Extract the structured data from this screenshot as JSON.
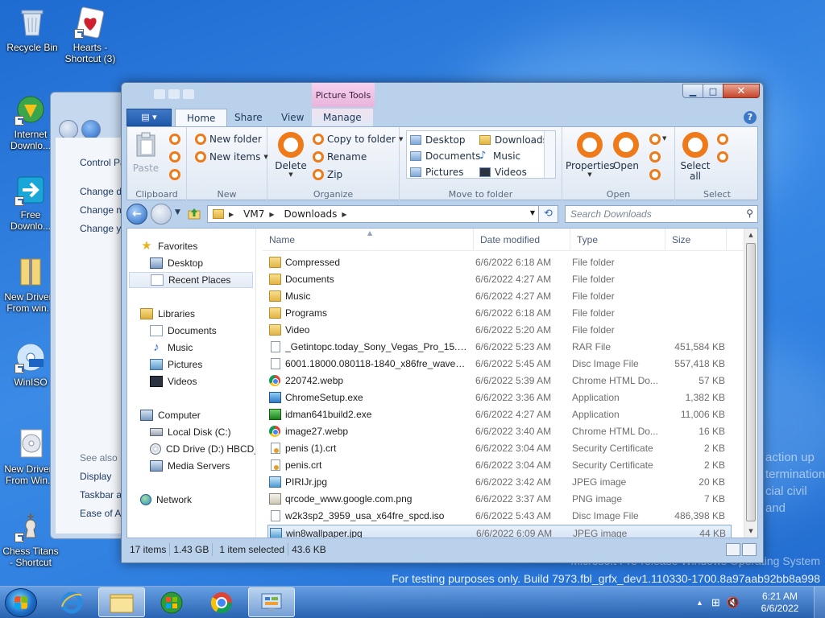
{
  "desktop": {
    "icons": [
      {
        "label": "Recycle Bin"
      },
      {
        "label": "Hearts - Shortcut (3)"
      },
      {
        "label": "Internet Downlo..."
      },
      {
        "label": "Free Downlo..."
      },
      {
        "label": "New Drivers From win..."
      },
      {
        "label": "WinISO"
      },
      {
        "label": "New Drivers From Win..."
      },
      {
        "label": "Chess Titans - Shortcut"
      }
    ],
    "watermark_line1": "Microsoft Pre-release Windows Operating System",
    "watermark_line2": "For testing purposes only. Build 7973.fbl_grfx_dev1.110330-1700.8a97aab92bb8a998",
    "faint_text": [
      "action up",
      "termination",
      "cial civil and"
    ]
  },
  "bg_window": {
    "links": [
      "Control Pa",
      "Change d",
      "Change m",
      "Change yo",
      "See also",
      "Display",
      "Taskbar an",
      "Ease of Ac"
    ]
  },
  "explorer": {
    "context_tab_group": "Picture Tools",
    "file_tab": "▤ ▾",
    "tabs": [
      "Home",
      "Share",
      "View",
      "Manage"
    ],
    "ribbon": {
      "clipboard": {
        "paste": "Paste",
        "label": "Clipboard"
      },
      "new": {
        "new_folder": "New folder",
        "new_items": "New items",
        "label": "New"
      },
      "organize": {
        "delete": "Delete",
        "copy_to": "Copy to folder",
        "rename": "Rename",
        "zip": "Zip",
        "label": "Organize"
      },
      "move": {
        "desktop": "Desktop",
        "downloads": "Downloads",
        "documents": "Documents",
        "music": "Music",
        "pictures": "Pictures",
        "videos": "Videos",
        "label": "Move to folder"
      },
      "open": {
        "properties": "Properties",
        "open": "Open",
        "label": "Open"
      },
      "select": {
        "select_all_1": "Select",
        "select_all_2": "all",
        "label": "Select"
      }
    },
    "address": {
      "segments": [
        "VM7",
        "Downloads"
      ],
      "search_placeholder": "Search Downloads"
    },
    "nav": {
      "favorites": "Favorites",
      "desktop": "Desktop",
      "recent": "Recent Places",
      "libraries": "Libraries",
      "documents": "Documents",
      "music": "Music",
      "pictures": "Pictures",
      "videos": "Videos",
      "computer": "Computer",
      "local_disk": "Local Disk (C:)",
      "cd_drive": "CD Drive (D:) HBCD_",
      "media": "Media Servers",
      "network": "Network"
    },
    "columns": {
      "name": "Name",
      "date": "Date modified",
      "type": "Type",
      "size": "Size"
    },
    "files": [
      {
        "name": "Compressed",
        "date": "6/6/2022 6:18 AM",
        "type": "File folder",
        "size": "",
        "icon": "folder"
      },
      {
        "name": "Documents",
        "date": "6/6/2022 4:27 AM",
        "type": "File folder",
        "size": "",
        "icon": "folder"
      },
      {
        "name": "Music",
        "date": "6/6/2022 4:27 AM",
        "type": "File folder",
        "size": "",
        "icon": "folder"
      },
      {
        "name": "Programs",
        "date": "6/6/2022 6:18 AM",
        "type": "File folder",
        "size": "",
        "icon": "folder"
      },
      {
        "name": "Video",
        "date": "6/6/2022 5:20 AM",
        "type": "File folder",
        "size": "",
        "icon": "folder"
      },
      {
        "name": "_Getintopc.today_Sony_Vegas_Pro_15.0.0...",
        "date": "6/6/2022 5:23 AM",
        "type": "RAR File",
        "size": "451,584 KB",
        "icon": "file"
      },
      {
        "name": "6001.18000.080118-1840_x86fre_wave1_Se...",
        "date": "6/6/2022 5:45 AM",
        "type": "Disc Image File",
        "size": "557,418 KB",
        "icon": "disc"
      },
      {
        "name": "220742.webp",
        "date": "6/6/2022 5:39 AM",
        "type": "Chrome HTML Do...",
        "size": "57 KB",
        "icon": "chrome"
      },
      {
        "name": "ChromeSetup.exe",
        "date": "6/6/2022 3:36 AM",
        "type": "Application",
        "size": "1,382 KB",
        "icon": "app"
      },
      {
        "name": "idman641build2.exe",
        "date": "6/6/2022 4:27 AM",
        "type": "Application",
        "size": "11,006 KB",
        "icon": "idm"
      },
      {
        "name": "image27.webp",
        "date": "6/6/2022 3:40 AM",
        "type": "Chrome HTML Do...",
        "size": "16 KB",
        "icon": "chrome"
      },
      {
        "name": "penis (1).crt",
        "date": "6/6/2022 3:04 AM",
        "type": "Security Certificate",
        "size": "2 KB",
        "icon": "cert"
      },
      {
        "name": "penis.crt",
        "date": "6/6/2022 3:04 AM",
        "type": "Security Certificate",
        "size": "2 KB",
        "icon": "cert"
      },
      {
        "name": "PIRIJr.jpg",
        "date": "6/6/2022 3:42 AM",
        "type": "JPEG image",
        "size": "20 KB",
        "icon": "img"
      },
      {
        "name": "qrcode_www.google.com.png",
        "date": "6/6/2022 3:37 AM",
        "type": "PNG image",
        "size": "7 KB",
        "icon": "png"
      },
      {
        "name": "w2k3sp2_3959_usa_x64fre_spcd.iso",
        "date": "6/6/2022 5:43 AM",
        "type": "Disc Image File",
        "size": "486,398 KB",
        "icon": "disc"
      },
      {
        "name": "win8wallpaper.jpg",
        "date": "6/6/2022 6:09 AM",
        "type": "JPEG image",
        "size": "44 KB",
        "icon": "img",
        "selected": true
      }
    ],
    "status": {
      "items": "17 items",
      "size": "1.43 GB",
      "selected": "1 item selected",
      "selected_size": "43.6 KB"
    }
  },
  "taskbar": {
    "time": "6:21 AM",
    "date": "6/6/2022"
  }
}
